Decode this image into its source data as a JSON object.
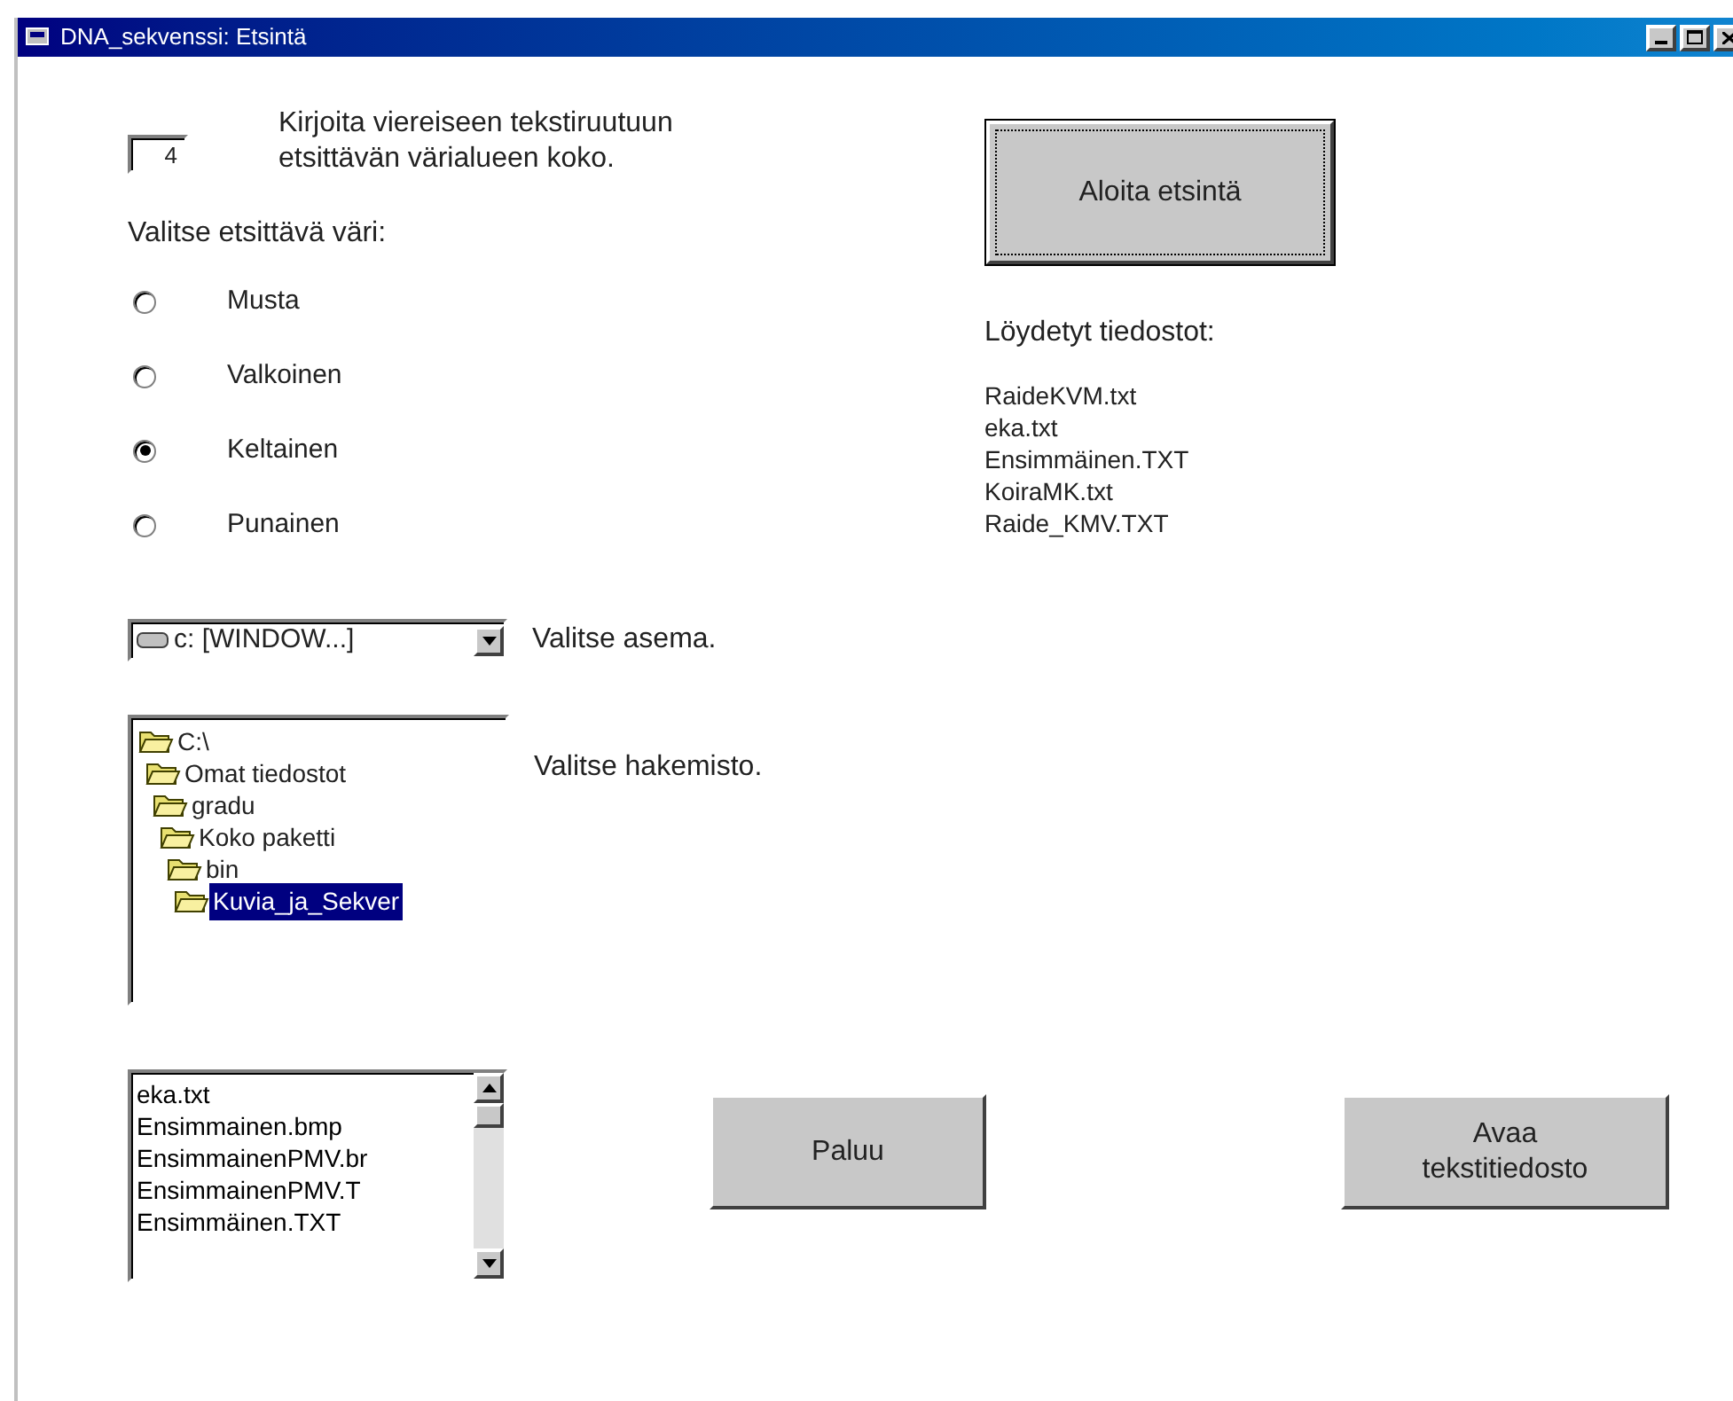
{
  "window": {
    "title": "DNA_sekvenssi: Etsintä"
  },
  "size_field": {
    "value": "4"
  },
  "size_instruction": "Kirjoita viereiseen tekstiruutuun etsittävän värialueen koko.",
  "color_prompt": "Valitse etsittävä väri:",
  "colors": [
    {
      "label": "Musta",
      "selected": false
    },
    {
      "label": "Valkoinen",
      "selected": false
    },
    {
      "label": "Keltainen",
      "selected": true
    },
    {
      "label": "Punainen",
      "selected": false
    }
  ],
  "drive": {
    "value": "c: [WINDOW...]",
    "label": "Valitse asema."
  },
  "directories": {
    "label": "Valitse hakemisto.",
    "tree": [
      {
        "name": "C:\\",
        "selected": false,
        "children": [
          {
            "name": "Omat tiedostot",
            "selected": false,
            "children": [
              {
                "name": "gradu",
                "selected": false,
                "children": [
                  {
                    "name": "Koko paketti",
                    "selected": false,
                    "children": [
                      {
                        "name": "bin",
                        "selected": false,
                        "children": [
                          {
                            "name": "Kuvia_ja_Sekver",
                            "selected": true
                          }
                        ]
                      }
                    ]
                  }
                ]
              }
            ]
          }
        ]
      }
    ]
  },
  "files": [
    "eka.txt",
    "Ensimmainen.bmp",
    "EnsimmainenPMV.br",
    "EnsimmainenPMV.T",
    "Ensimmäinen.TXT"
  ],
  "search_button": "Aloita etsintä",
  "found_label": "Löydetyt tiedostot:",
  "found_files": [
    "RaideKVM.txt",
    "eka.txt",
    "Ensimmäinen.TXT",
    "KoiraMK.txt",
    "Raide_KMV.TXT"
  ],
  "buttons": [
    {
      "label": "Paluu"
    },
    {
      "label": "Avaa tekstitiedosto"
    }
  ]
}
